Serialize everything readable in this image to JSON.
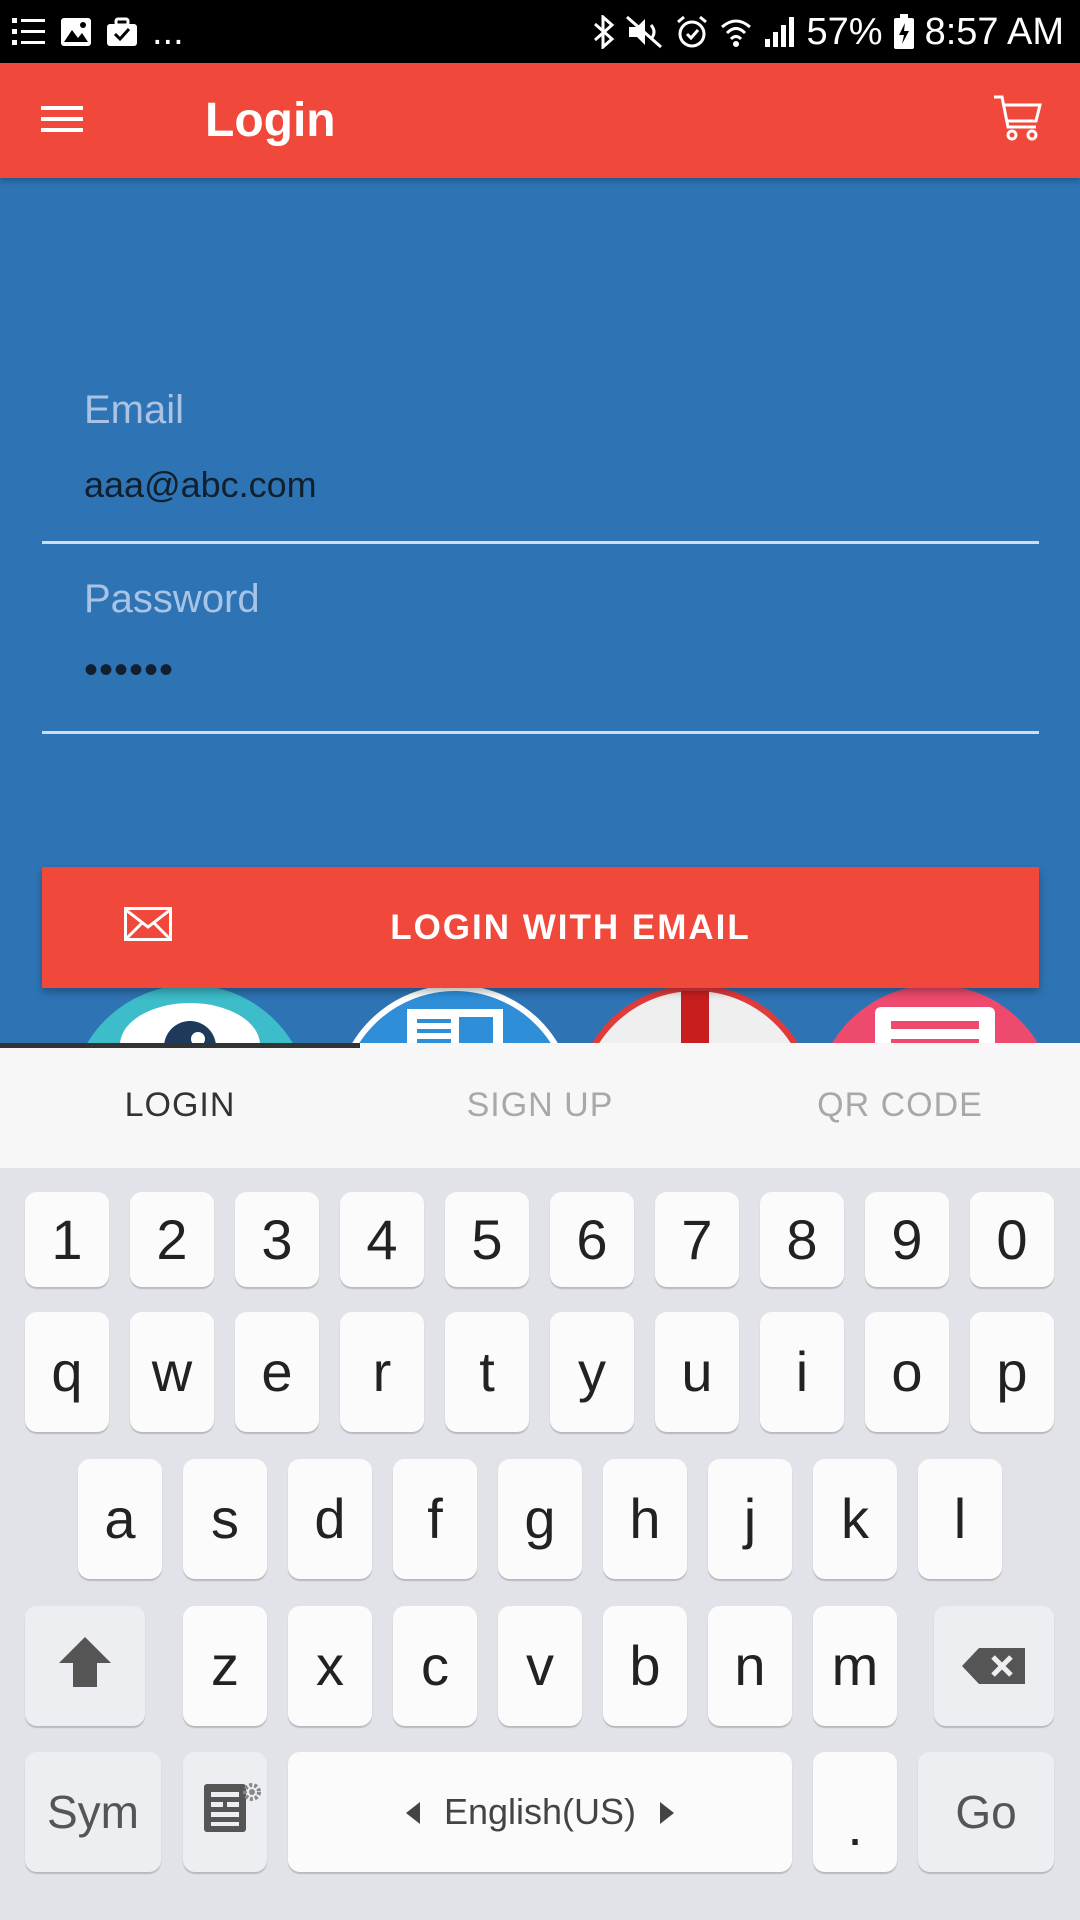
{
  "status_bar": {
    "left_icons": [
      "list-icon",
      "image-icon",
      "briefcase-icon"
    ],
    "overflow": "...",
    "right_icons": [
      "bluetooth-icon",
      "mute-icon",
      "alarm-icon",
      "wifi-icon",
      "signal-icon",
      "battery-icon"
    ],
    "battery": "57%",
    "time": "8:57 AM"
  },
  "app_bar": {
    "title": "Login",
    "menu_icon": "hamburger-icon",
    "cart_icon": "cart-icon",
    "color": "#f0483b"
  },
  "form": {
    "email_label": "Email",
    "email_value": "aaa@abc.com",
    "password_label": "Password",
    "password_value": "••••••",
    "submit_label": "LOGIN WITH EMAIL",
    "submit_icon": "mail-icon"
  },
  "tabs": [
    {
      "label": "LOGIN",
      "active": true
    },
    {
      "label": "SIGN UP",
      "active": false
    },
    {
      "label": "QR CODE",
      "active": false
    }
  ],
  "keyboard": {
    "row_numbers": [
      "1",
      "2",
      "3",
      "4",
      "5",
      "6",
      "7",
      "8",
      "9",
      "0"
    ],
    "row_1": [
      "q",
      "w",
      "e",
      "r",
      "t",
      "y",
      "u",
      "i",
      "o",
      "p"
    ],
    "row_2": [
      "a",
      "s",
      "d",
      "f",
      "g",
      "h",
      "j",
      "k",
      "l"
    ],
    "row_3": [
      "z",
      "x",
      "c",
      "v",
      "b",
      "n",
      "m"
    ],
    "shift_icon": "shift-arrow-icon",
    "backspace_icon": "backspace-icon",
    "sym_label": "Sym",
    "clipboard_icon": "clipboard-icon",
    "space_label": "English(US)",
    "period_label": ".",
    "go_label": "Go"
  },
  "colors": {
    "background": "#2e74b5",
    "accent": "#f0483b",
    "keyboard_bg": "#e1e3e9"
  }
}
